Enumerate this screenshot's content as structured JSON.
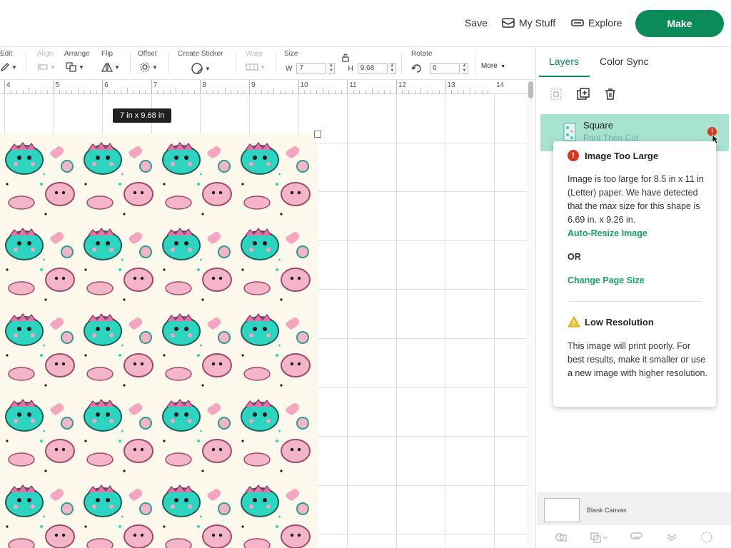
{
  "header": {
    "save_label": "Save",
    "mystuff_label": "My Stuff",
    "explore_label": "Explore",
    "make_label": "Make"
  },
  "toolbar": {
    "edit_label": "Edit",
    "align_label": "Align",
    "arrange_label": "Arrange",
    "flip_label": "Flip",
    "offset_label": "Offset",
    "sticker_label": "Create Sticker",
    "warp_label": "Warp",
    "size_label": "Size",
    "w_label": "W",
    "w_value": "7",
    "h_label": "H",
    "h_value": "9.68",
    "rotate_label": "Rotate",
    "rotate_value": "0",
    "more_label": "More"
  },
  "ruler": {
    "numbers": [
      "4",
      "5",
      "6",
      "7",
      "8",
      "9",
      "10",
      "11",
      "12",
      "13",
      "14"
    ]
  },
  "canvas": {
    "dimension_label": "7  in x 9.68  in"
  },
  "panel": {
    "tab_layers": "Layers",
    "tab_colorsync": "Color Sync",
    "layer_name": "Square",
    "layer_sub": "Print Then Cut",
    "blank_canvas_label": "Blank Canvas"
  },
  "popup": {
    "title": "Image Too Large",
    "body": "Image is too large for 8.5 in x 11 in (Letter) paper. We have detected that the max size for this shape is 6.69 in. x 9.26 in.",
    "link_resize": "Auto-Resize Image",
    "or_label": "OR",
    "link_page": "Change Page Size",
    "low_title": "Low Resolution",
    "low_body": "This image will print poorly. For best results, make it smaller or use a new image with higher resolution."
  },
  "colors": {
    "accent": "#0b8a5a",
    "link": "#19a06b",
    "error": "#d9381e",
    "warning": "#f2c230",
    "layer_selected": "#a8e3cf",
    "pattern_teal": "#2dd4bf",
    "pattern_pink": "#f5b5c8"
  }
}
